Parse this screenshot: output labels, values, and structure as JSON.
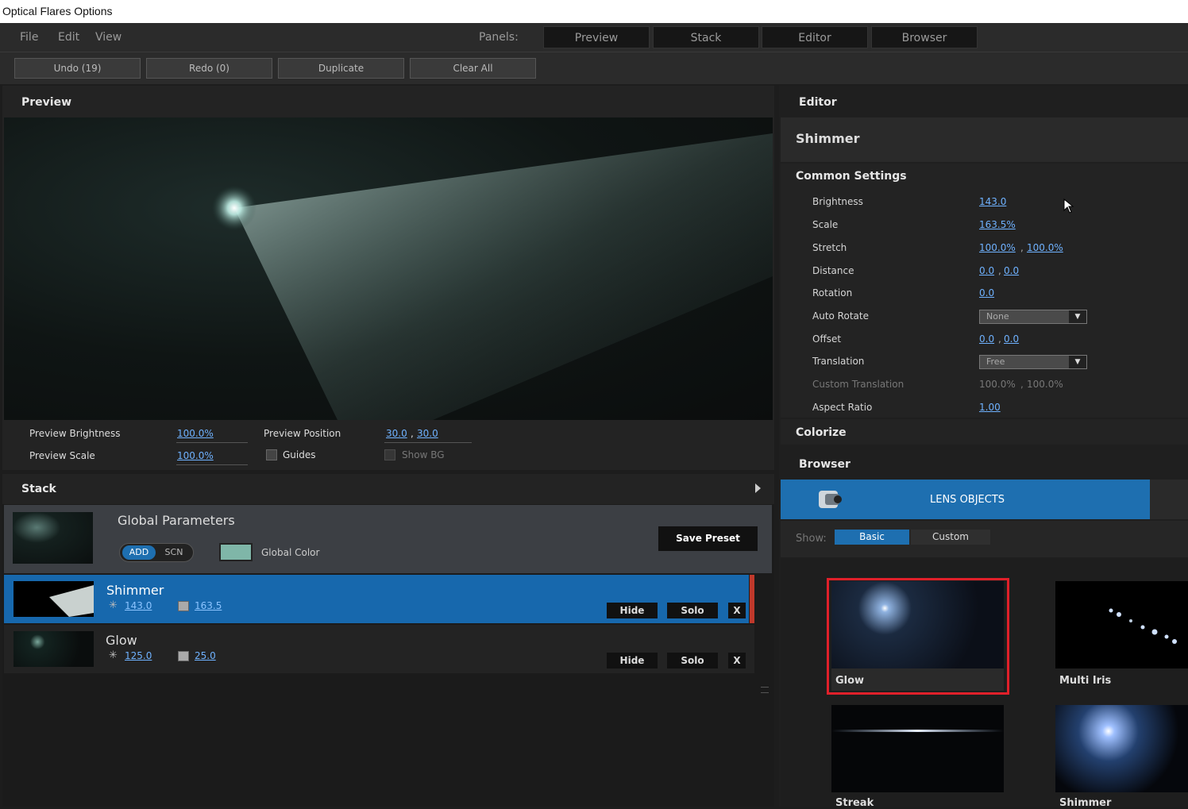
{
  "window": {
    "title": "Optical Flares Options"
  },
  "menu": {
    "file": "File",
    "edit": "Edit",
    "view": "View",
    "panels_label": "Panels:",
    "panels": [
      "Preview",
      "Stack",
      "Editor",
      "Browser"
    ]
  },
  "toolbar": {
    "undo": "Undo (19)",
    "redo": "Redo (0)",
    "duplicate": "Duplicate",
    "clear_all": "Clear All"
  },
  "preview": {
    "title": "Preview",
    "brightness_label": "Preview Brightness",
    "brightness": "100.0%",
    "scale_label": "Preview Scale",
    "scale": "100.0%",
    "position_label": "Preview Position",
    "pos_x": "30.0",
    "pos_y": "30.0",
    "sep": ",",
    "guides": "Guides",
    "show_bg": "Show BG"
  },
  "stack": {
    "title": "Stack",
    "global": {
      "title": "Global Parameters",
      "add": "ADD",
      "scn": "SCN",
      "color_label": "Global Color",
      "color": "#7fb6a8",
      "save_preset": "Save Preset"
    },
    "items": [
      {
        "name": "Shimmer",
        "brightness": "143.0",
        "scale": "163.5",
        "hide": "Hide",
        "solo": "Solo",
        "remove": "X"
      },
      {
        "name": "Glow",
        "brightness": "125.0",
        "scale": "25.0",
        "hide": "Hide",
        "solo": "Solo",
        "remove": "X"
      }
    ]
  },
  "editor": {
    "title": "Editor",
    "object": "Shimmer",
    "common": "Common Settings",
    "brightness_label": "Brightness",
    "brightness": "143.0",
    "scale_label": "Scale",
    "scale": "163.5%",
    "stretch_label": "Stretch",
    "stretch_x": "100.0%",
    "stretch_y": "100.0%",
    "distance_label": "Distance",
    "distance_x": "0.0",
    "distance_y": "0.0",
    "rotation_label": "Rotation",
    "rotation": "0.0",
    "autorotate_label": "Auto Rotate",
    "autorotate": "None",
    "offset_label": "Offset",
    "offset_x": "0.0",
    "offset_y": "0.0",
    "translation_label": "Translation",
    "translation": "Free",
    "custom_translation_label": "Custom Translation",
    "ct_x": "100.0%",
    "ct_y": "100.0%",
    "aspect_label": "Aspect Ratio",
    "aspect": "1.00",
    "colorize": "Colorize"
  },
  "browser": {
    "title": "Browser",
    "tab": "LENS OBJECTS",
    "show_label": "Show:",
    "basic": "Basic",
    "custom": "Custom",
    "items": [
      "Glow",
      "Multi Iris",
      "Streak",
      "Shimmer"
    ]
  },
  "colors": {
    "accent": "#1e6fb0",
    "selection": "#1768ad",
    "link": "#6fb2ff",
    "highlight_border": "#e0202a"
  }
}
